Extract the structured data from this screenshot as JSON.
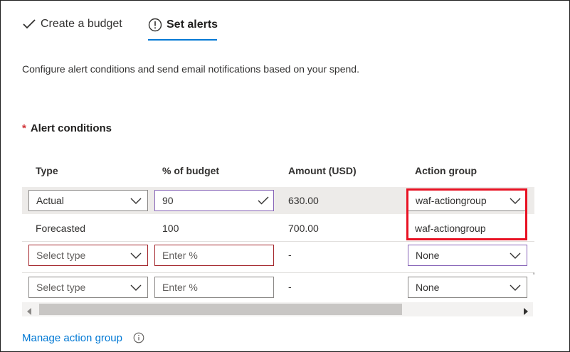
{
  "tabs": {
    "create": "Create a budget",
    "alerts": "Set alerts"
  },
  "description": "Configure alert conditions and send email notifications based on your spend.",
  "section": {
    "required_mark": "*",
    "title": "Alert conditions"
  },
  "table": {
    "headers": {
      "type": "Type",
      "percent": "% of budget",
      "amount": "Amount (USD)",
      "action": "Action group"
    },
    "rows": [
      {
        "type": "Actual",
        "percent": "90",
        "amount": "630.00",
        "action": "waf-actiongroup"
      },
      {
        "type": "Forecasted",
        "percent": "100",
        "amount": "700.00",
        "action": "waf-actiongroup"
      },
      {
        "type_placeholder": "Select type",
        "percent_placeholder": "Enter %",
        "amount": "-",
        "action": "None"
      },
      {
        "type_placeholder": "Select type",
        "percent_placeholder": "Enter %",
        "amount": "-",
        "action": "None"
      }
    ]
  },
  "manage_link": "Manage action group",
  "overflow_tick": "'",
  "colors": {
    "accent": "#0078d4",
    "required": "#d13438",
    "highlight": "#e81123",
    "valid_border": "#8764b8",
    "invalid_border": "#a4262c"
  }
}
